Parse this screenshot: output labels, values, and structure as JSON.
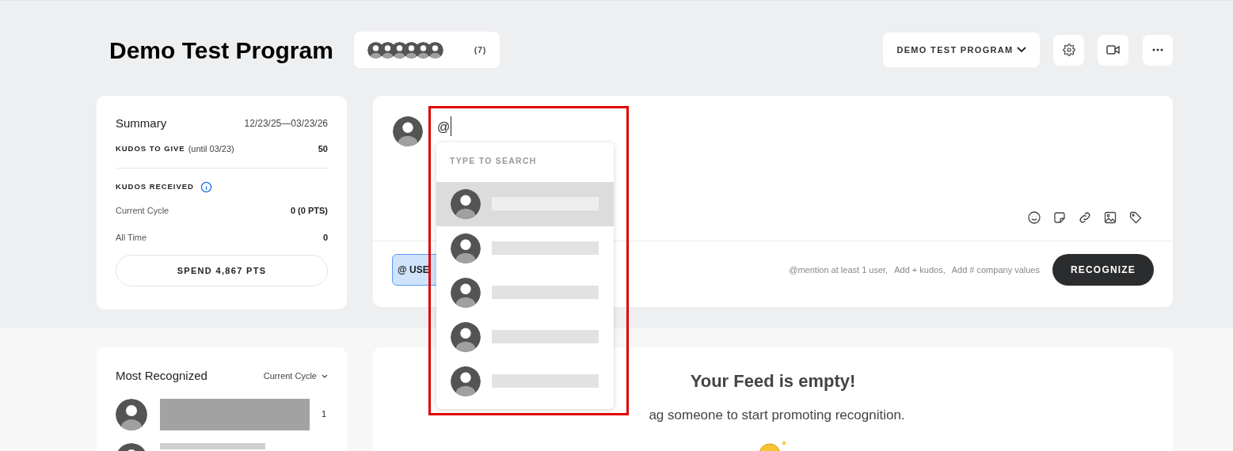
{
  "header": {
    "title": "Demo Test Program",
    "member_count": "(7)",
    "program_select": "DEMO TEST PROGRAM"
  },
  "summary": {
    "title": "Summary",
    "dates": "12/23/25—03/23/26",
    "to_give_label": "KUDOS TO GIVE",
    "to_give_note": "(until 03/23)",
    "to_give_value": "50",
    "received_label": "KUDOS RECEIVED",
    "rows": [
      {
        "label": "Current Cycle",
        "value": "0 (0 PTS)"
      },
      {
        "label": "All Time",
        "value": "0"
      }
    ],
    "spend_button": "SPEND 4,867 PTS"
  },
  "composer": {
    "value": "@",
    "chip": "@ USE",
    "hints": [
      "@mention at least 1 user,",
      "Add + kudos,",
      "Add # company values"
    ],
    "submit": "RECOGNIZE"
  },
  "mention_dropdown": {
    "heading": "TYPE TO SEARCH",
    "items": [
      {
        "selected": true
      },
      {
        "selected": false
      },
      {
        "selected": false
      },
      {
        "selected": false
      },
      {
        "selected": false
      }
    ]
  },
  "most_recognized": {
    "title": "Most Recognized",
    "filter": "Current Cycle",
    "rows": [
      {
        "count": "1"
      }
    ]
  },
  "feed": {
    "title": "Your Feed is empty!",
    "message": "ag someone to start promoting recognition."
  }
}
